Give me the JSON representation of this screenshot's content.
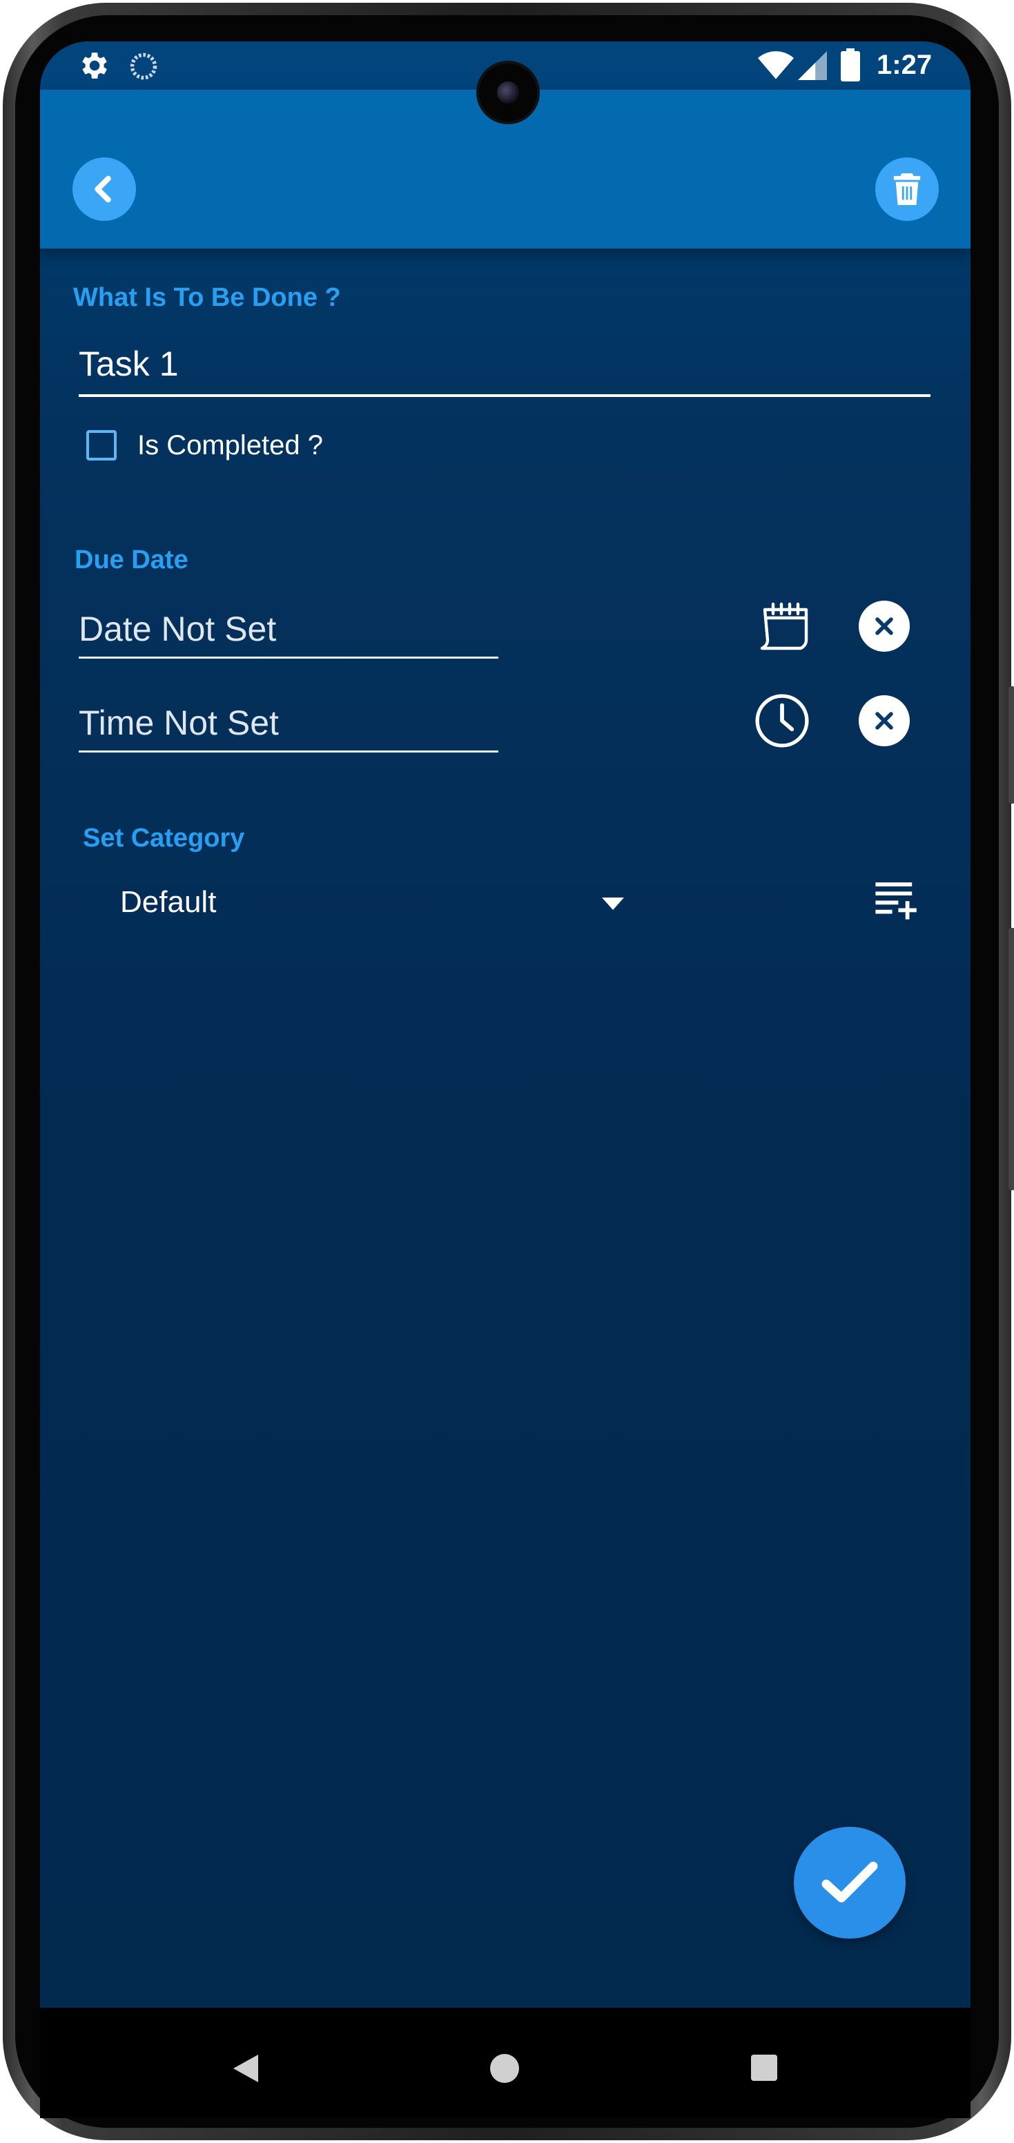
{
  "status_bar": {
    "time": "1:27"
  },
  "app_bar": {
    "back_icon": "chevron-left-icon",
    "delete_icon": "trash-icon"
  },
  "task": {
    "section_label": "What Is To Be Done ?",
    "name_value": "Task 1",
    "completed_label": "Is Completed ?",
    "completed": false
  },
  "due": {
    "section_label": "Due Date",
    "date_placeholder": "Date Not Set",
    "time_placeholder": "Time Not Set"
  },
  "category": {
    "section_label": "Set Category",
    "selected": "Default"
  },
  "colors": {
    "accent": "#27a0f4",
    "app_bar": "#036ab0",
    "background": "#022b52",
    "fab": "#2a8fe8"
  }
}
